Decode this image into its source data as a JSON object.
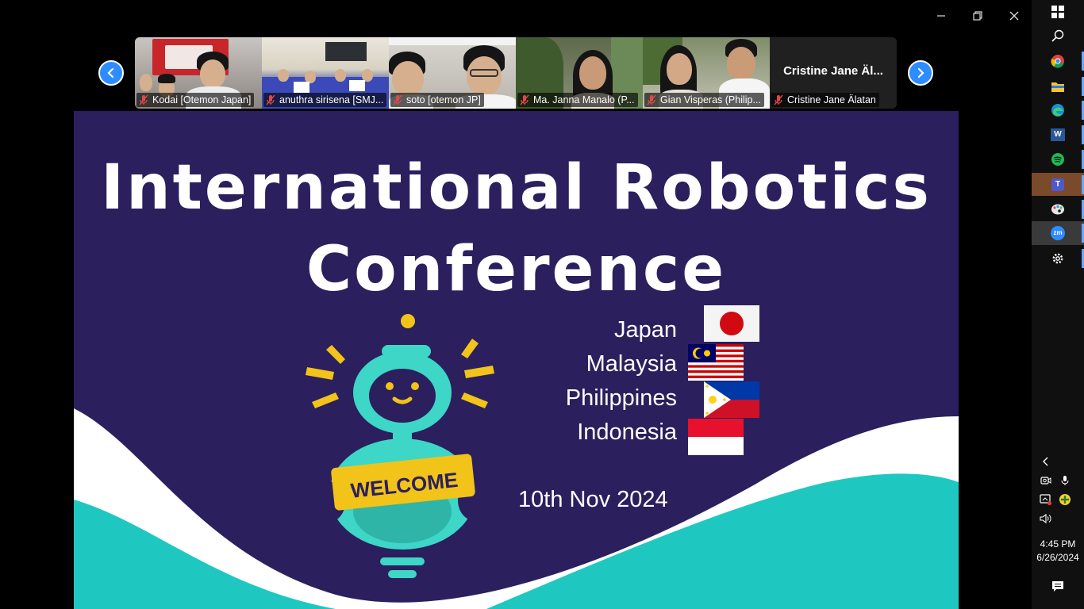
{
  "window": {
    "controls": [
      "minimize-icon",
      "restore-icon",
      "close-icon"
    ]
  },
  "participants": [
    {
      "name": "Kodai [Otemon Japan]",
      "muted": true
    },
    {
      "name": "anuthra sirisena [SMJ...",
      "muted": true
    },
    {
      "name": "soto [otemon JP]",
      "muted": true
    },
    {
      "name": "Ma. Janna Manalo (P...",
      "muted": true
    },
    {
      "name": "Gian Visperas (Philip...",
      "muted": true
    },
    {
      "name": "Cristine Jane Älatan",
      "display_name": "Cristine Jane Äl...",
      "muted": true,
      "video_off": true
    }
  ],
  "slide": {
    "title_line1": "International Robotics",
    "title_line2": "Conference",
    "welcome": "WELCOME",
    "countries": [
      "Japan",
      "Malaysia",
      "Philippines",
      "Indonesia"
    ],
    "date": "10th Nov 2024",
    "colors": {
      "background": "#2b1f5e",
      "wave_white": "#ffffff",
      "wave_teal": "#1ec8c0",
      "robot_teal": "#3ed6c6",
      "accent_yellow": "#f2c318"
    }
  },
  "taskbar": {
    "apps": [
      "windows-start-icon",
      "search-icon",
      "chrome-icon",
      "file-explorer-icon",
      "edge-icon",
      "word-icon",
      "spotify-icon",
      "teams-icon",
      "paint-icon",
      "zoom-icon",
      "settings-icon"
    ],
    "zoom_label": "zm",
    "word_label": "W",
    "clock_time": "4:45 PM",
    "clock_date": "6/26/2024"
  }
}
